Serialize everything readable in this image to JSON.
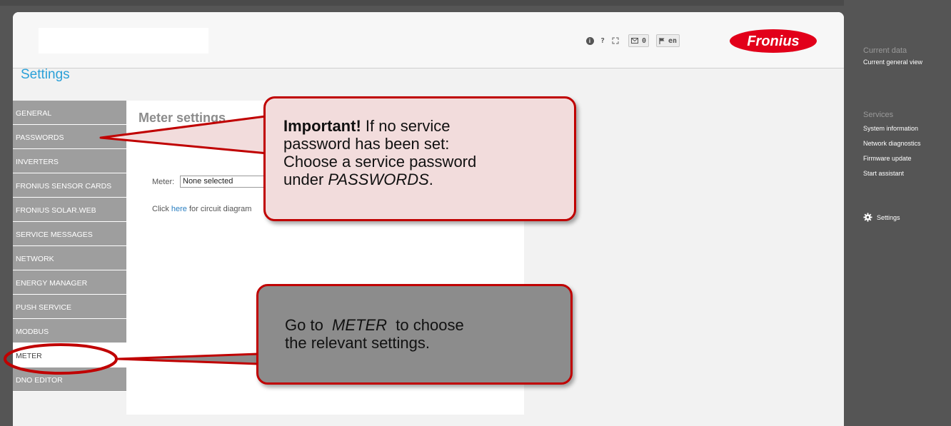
{
  "header": {
    "tools": {
      "help": "?",
      "messages_count": "0",
      "language": "en"
    },
    "logo_text": "Fronius"
  },
  "page_title": "Settings",
  "nav": {
    "items": [
      {
        "label": "GENERAL",
        "active": false
      },
      {
        "label": "PASSWORDS",
        "active": false
      },
      {
        "label": "INVERTERS",
        "active": false
      },
      {
        "label": "FRONIUS SENSOR CARDS",
        "active": false
      },
      {
        "label": "FRONIUS SOLAR.WEB",
        "active": false
      },
      {
        "label": "SERVICE MESSAGES",
        "active": false
      },
      {
        "label": "NETWORK",
        "active": false
      },
      {
        "label": "ENERGY MANAGER",
        "active": false
      },
      {
        "label": "PUSH SERVICE",
        "active": false
      },
      {
        "label": "MODBUS",
        "active": false
      },
      {
        "label": "METER",
        "active": true
      },
      {
        "label": "DNO EDITOR",
        "active": false
      }
    ]
  },
  "content": {
    "title": "Meter settings",
    "meter_label": "Meter:",
    "meter_value": "None selected",
    "click_prefix": "Click ",
    "click_link": "here",
    "click_suffix": " for circuit diagram"
  },
  "sidebar": {
    "current_data_heading": "Current data",
    "current_general_view": "Current general view",
    "services_heading": "Services",
    "services": [
      "System information",
      "Network diagnostics",
      "Firmware update",
      "Start assistant"
    ],
    "settings_label": "Settings"
  },
  "callouts": {
    "important": {
      "bold": "Important!",
      "line1_rest": " If no service",
      "line2": "password has been set:",
      "line3": "Choose a service password",
      "line4_prefix": "under ",
      "line4_italic": "PASSWORDS",
      "line4_suffix": "."
    },
    "meter": {
      "line1_prefix": "Go to  ",
      "line1_italic": "METER",
      "line1_suffix": "  to choose",
      "line2": "the relevant settings."
    }
  },
  "colors": {
    "accent_blue": "#2aa0d8",
    "fronius_red": "#e2001a",
    "callout_border": "#c00000",
    "nav_gray": "#9e9e9e"
  }
}
